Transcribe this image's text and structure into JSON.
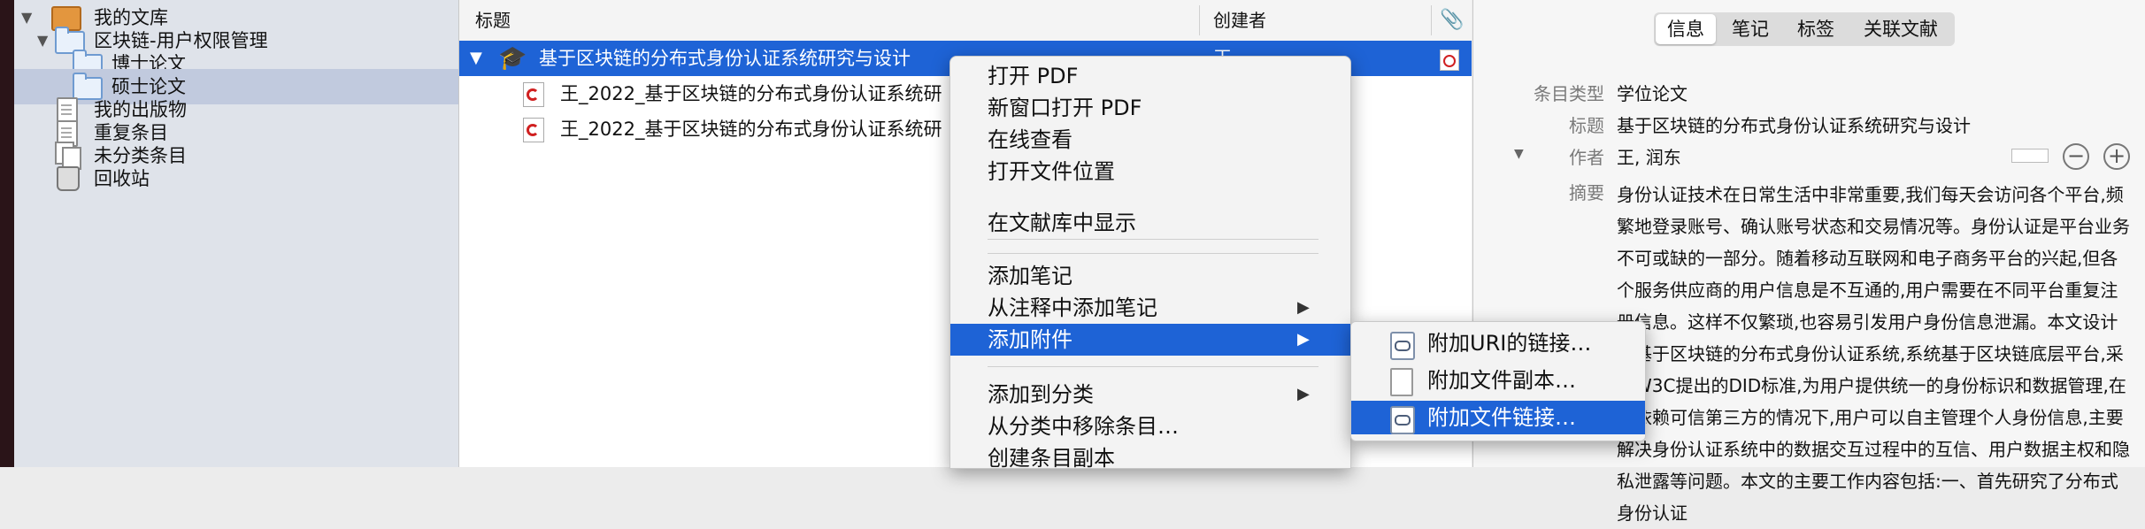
{
  "library": {
    "my_library": "我的文库",
    "collection": "区块链-用户权限管理",
    "subcollections": [
      "博士论文",
      "硕士论文"
    ],
    "my_publications": "我的出版物",
    "duplicates": "重复条目",
    "unfiled": "未分类条目",
    "trash": "回收站"
  },
  "items": {
    "columns": {
      "title": "标题",
      "creator": "创建者"
    },
    "rows": [
      {
        "title": "基于区块链的分布式身份认证系统研究与设计",
        "creator": "王"
      },
      {
        "title": "王_2022_基于区块链的分布式身份认证系统研"
      },
      {
        "title": "王_2022_基于区块链的分布式身份认证系统研"
      }
    ]
  },
  "context_menu": {
    "items": [
      "打开 PDF",
      "新窗口打开 PDF",
      "在线查看",
      "打开文件位置",
      "在文献库中显示",
      "添加笔记",
      "从注释中添加笔记",
      "添加附件",
      "添加到分类",
      "从分类中移除条目…",
      "创建条目副本"
    ],
    "submenu_arrow": "▶"
  },
  "submenu": {
    "items": [
      "附加URI的链接…",
      "附加文件副本…",
      "附加文件链接…"
    ]
  },
  "info": {
    "tabs": [
      "信息",
      "笔记",
      "标签",
      "关联文献"
    ],
    "fields": {
      "item_type_label": "条目类型",
      "item_type_value": "学位论文",
      "title_label": "标题",
      "title_value": "基于区块链的分布式身份认证系统研究与设计",
      "author_label": "作者",
      "author_value": "王, 润东",
      "abstract_label": "摘要",
      "abstract_value": "身份认证技术在日常生活中非常重要,我们每天会访问各个平台,频繁地登录账号、确认账号状态和交易情况等。身份认证是平台业务不可或缺的一部分。随着移动互联网和电子商务平台的兴起,但各个服务供应商的用户信息是不互通的,用户需要在不同平台重复注册信息。这样不仅繁琐,也容易引发用户身份信息泄漏。本文设计了基于区块链的分布式身份认证系统,系统基于区块链底层平台,采用W3C提出的DID标准,为用户提供统一的身份标识和数据管理,在不依赖可信第三方的情况下,用户可以自主管理个人身份信息,主要解决身份认证系统中的数据交互过程中的互信、用户数据主权和隐私泄露等问题。本文的主要工作内容包括:一、首先研究了分布式身份认证"
    }
  },
  "colors": {
    "selection": "#1e63d6",
    "sidebar_bg": "#dfe3ea",
    "sidebar_selection": "#c1cade"
  }
}
